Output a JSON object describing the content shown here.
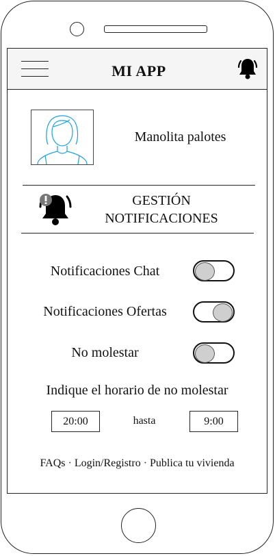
{
  "device": {
    "name": "phone-frame"
  },
  "app": {
    "title": "MI APP",
    "menu_icon": "hamburger-menu-icon",
    "notification_icon": "bell-icon"
  },
  "profile": {
    "avatar_icon": "female-user-avatar-icon",
    "name": "Manolita palotes"
  },
  "section": {
    "icon": "bell-alert-icon",
    "title_line1": "GESTIÓN",
    "title_line2": "NOTIFICACIONES"
  },
  "settings": [
    {
      "label": "Notificaciones Chat",
      "enabled": false
    },
    {
      "label": "Notificaciones Ofertas",
      "enabled": true
    },
    {
      "label": "No molestar",
      "enabled": false
    }
  ],
  "schedule": {
    "label": "Indique el horario de no molestar",
    "from": "20:00",
    "until_label": "hasta",
    "to": "9:00"
  },
  "footer": {
    "links": [
      "FAQs",
      "Login/Registro",
      "Publica tu vivienda"
    ],
    "separator": "·"
  },
  "colors": {
    "appbar_bg": "#f5f5f5",
    "avatar_stroke": "#1ba1e2",
    "toggle_knob": "#cfcfcf"
  }
}
